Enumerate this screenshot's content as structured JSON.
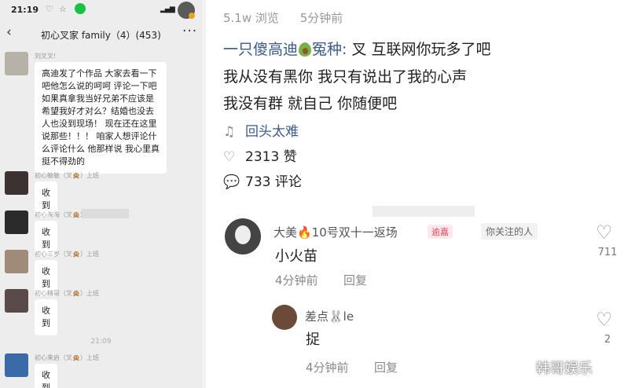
{
  "chat": {
    "status_time": "21:19",
    "title": "初心叉家 family（4）(453)",
    "messages": [
      {
        "sender": "刘叉叉!",
        "text": "高迪发了个作品 大家去看一下吧他怎么说的呵呵 评论一下吧如果真拿我当好兄弟不应该是希望我好才对么？结婚也没去人也没到现场！ 现在还在这里说那些！！！ 咱家人想评论什么评论什么 他那样说 我心里真挺不得劲的"
      },
      {
        "sender": "初心敏敏（叉🙊）上班",
        "text": "收到"
      },
      {
        "sender": "初心淘淘（叉🙊）",
        "text": "收到"
      },
      {
        "sender": "初心三岁（叉🙊）上班",
        "text": "收到"
      },
      {
        "sender": "初心精哥（叉🙊）上班",
        "text": "收到"
      },
      {
        "sender": "初心来启（叉🙊）上班",
        "text": "收到"
      }
    ],
    "timestamp": "21:09"
  },
  "post": {
    "views": "5.1w 浏览",
    "time_ago": "5分钟前",
    "author": "一只傻高迪",
    "author_suffix": "冤种:",
    "line1": "叉 互联网你玩多了吧",
    "line2": "我从没有黑你 我只有说出了我的心声",
    "line3": "我没有群 就自己 你随便吧",
    "music": "回头太难",
    "likes": "2313 赞",
    "comments": "733 评论"
  },
  "comment": {
    "name": "大美🔥10号双十一返场",
    "badge": "逾嘉",
    "follow_tag": "你关注的人",
    "text": "小火苗",
    "time": "4分钟前",
    "reply": "回复",
    "like_count": "711"
  },
  "subcomment": {
    "name": "差点🐰le",
    "text": "捉",
    "time": "4分钟前",
    "reply": "回复",
    "like_count": "2"
  },
  "watermark": "韩哥娱乐"
}
